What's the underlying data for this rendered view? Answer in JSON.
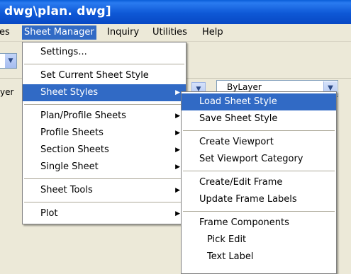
{
  "window": {
    "title": "dwg\\plan. dwg]"
  },
  "menubar": {
    "items": [
      {
        "label": "es"
      },
      {
        "label": "Sheet Manager"
      },
      {
        "label": "Inquiry"
      },
      {
        "label": "Utilities"
      },
      {
        "label": "Help"
      }
    ]
  },
  "toolbar": {
    "layer_label": "yer",
    "linetype_value": "ByLayer"
  },
  "sheet_manager_menu": {
    "items": [
      {
        "label": "Settings..."
      },
      {
        "label": "Set Current Sheet Style"
      },
      {
        "label": "Sheet Styles"
      },
      {
        "label": "Plan/Profile Sheets"
      },
      {
        "label": "Profile Sheets"
      },
      {
        "label": "Section Sheets"
      },
      {
        "label": "Single Sheet"
      },
      {
        "label": "Sheet Tools"
      },
      {
        "label": "Plot"
      }
    ]
  },
  "sheet_styles_submenu": {
    "items": [
      {
        "label": "Load Sheet Style"
      },
      {
        "label": "Save Sheet Style"
      },
      {
        "label": "Create Viewport"
      },
      {
        "label": "Set Viewport Category"
      },
      {
        "label": "Create/Edit Frame"
      },
      {
        "label": "Update Frame Labels"
      },
      {
        "label": "Frame Components"
      },
      {
        "label": "Pick Edit"
      },
      {
        "label": "Text Label"
      }
    ]
  },
  "colors": {
    "highlight": "#316ac5",
    "titlebar": "#0a5fd8",
    "menu_background": "#ece9d8"
  }
}
